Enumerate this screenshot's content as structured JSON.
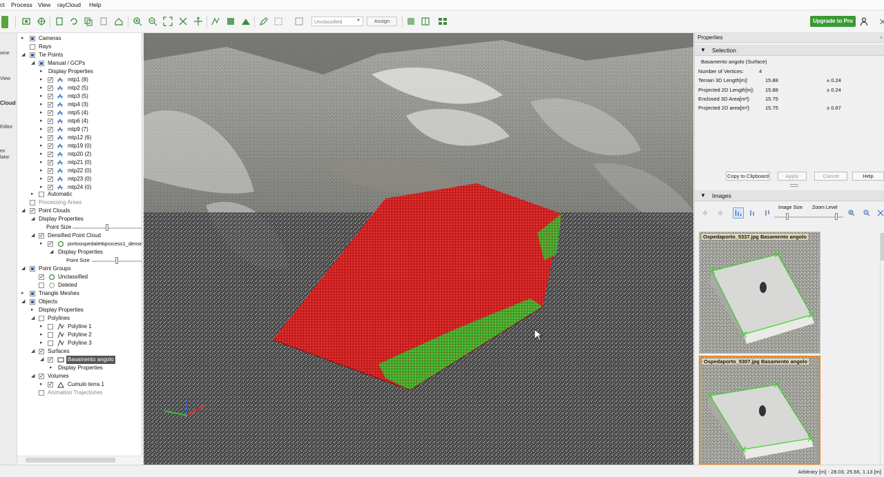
{
  "menubar": {
    "items": [
      "ct",
      "Process",
      "View",
      "rayCloud",
      "Help"
    ]
  },
  "toolbar": {
    "class_select": "Unclassified",
    "assign_label": "Assign",
    "upgrade_label": "Upgrade to Pro"
  },
  "left_strip": {
    "items": [
      "ome",
      "View",
      "Cloud",
      "Editor",
      "ex",
      "lator"
    ]
  },
  "tree": {
    "cameras": "Cameras",
    "rays": "Rays",
    "tie_points": "Tie Points",
    "manual_gcps": "Manual / GCPs",
    "display_properties": "Display Properties",
    "mtps": [
      "mtp1 (8)",
      "mtp2 (5)",
      "mtp3 (5)",
      "mtp4 (3)",
      "mtp5 (4)",
      "mtp6 (4)",
      "mtp9 (7)",
      "mtp12 (6)",
      "mtp19 (0)",
      "mtp20 (2)",
      "mtp21 (0)",
      "mtp22 (0)",
      "mtp23 (0)",
      "mtp24 (0)"
    ],
    "automatic": "Automatic",
    "processing_areas": "Processing Areas",
    "point_clouds": "Point Clouds",
    "pc_display_properties": "Display Properties",
    "point_size": "Point Size",
    "densified": "Densified Point Cloud",
    "dense_file": "portoospedalettiprocess1_dense",
    "dense_display_properties": "Display Properties",
    "dense_point_size": "Point Size",
    "point_groups": "Point Groups",
    "unclassified": "Unclassified",
    "deleted": "Deleted",
    "triangle_meshes": "Triangle Meshes",
    "objects": "Objects",
    "obj_display_properties": "Display Properties",
    "polylines": "Polylines",
    "polyline_items": [
      "Polyline 1",
      "Polyline 2",
      "Polyline 3"
    ],
    "surfaces": "Surfaces",
    "surface_item": "Basamento angolo",
    "surface_display_properties": "Display Properties",
    "volumes": "Volumes",
    "volume_item": "Cumulo terra 1",
    "animation": "Animation Trajectories"
  },
  "properties": {
    "title": "Properties",
    "selection_header": "Selection",
    "selected_name": "Basamento angolo (Surface)",
    "rows": [
      {
        "label": "Number of Vertices:",
        "value": "4",
        "err": ""
      },
      {
        "label": "Terrain 3D Length[m]:",
        "value": "15.88",
        "err": "± 0.24"
      },
      {
        "label": "Projected 2D Length[m]:",
        "value": "15.88",
        "err": "± 0.24"
      },
      {
        "label": "Enclosed 3D Area[m²]:",
        "value": "15.75",
        "err": ""
      },
      {
        "label": "Projected 2D area[m²]:",
        "value": "15.75",
        "err": "± 0.67"
      }
    ],
    "buttons": {
      "copy": "Copy to Clipboard",
      "apply": "Apply",
      "cancel": "Cancel",
      "help": "Help"
    }
  },
  "images": {
    "header": "Images",
    "image_size_label": "Image Size",
    "zoom_level_label": "Zoom Level",
    "thumbs": [
      {
        "caption": "Ospedaporto_5337.jpg Basamento angolo"
      },
      {
        "caption": "Ospedaporto_5307.jpg Basamento angolo"
      }
    ]
  },
  "status": {
    "text": "Arbitrary [m] - 28.03, 25.66, 1.13 [m]"
  },
  "colors": {
    "surface_red": "#d42a2a",
    "surface_green": "#3cd22a",
    "upgrade_green": "#3a9a32",
    "selected_thumb_border": "#e08a2a"
  }
}
